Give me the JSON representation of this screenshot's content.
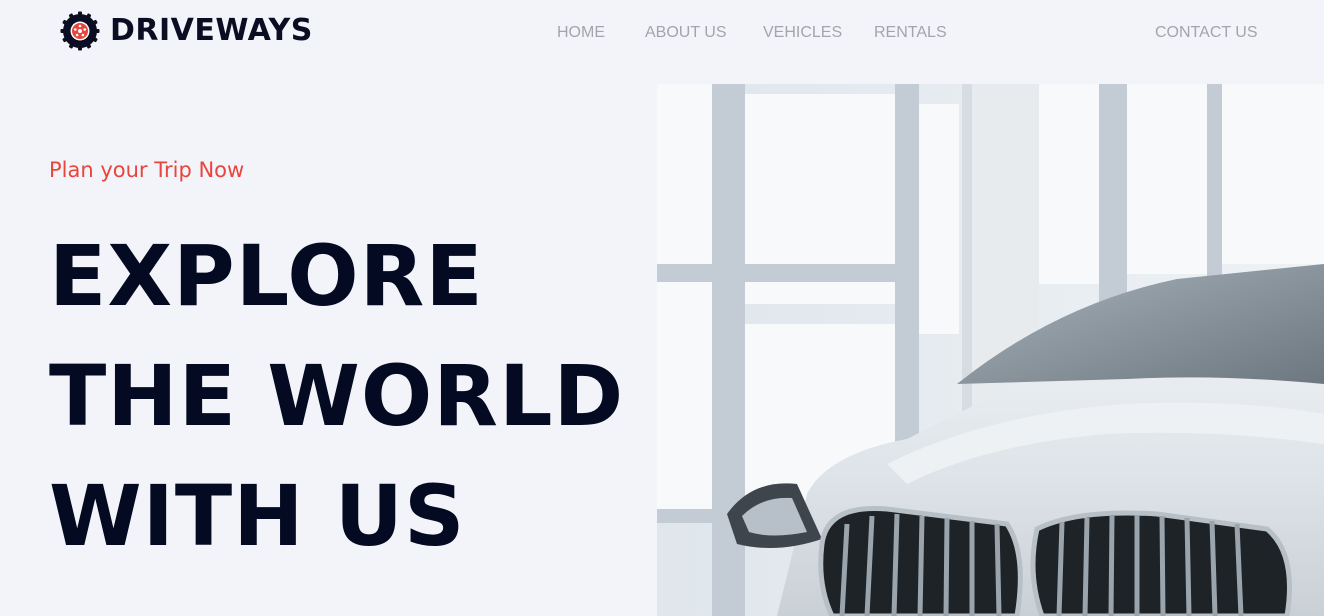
{
  "brand": {
    "name": "DRIVEWAYS",
    "accent_color": "#e8453c",
    "dark_color": "#0b0e23"
  },
  "nav": {
    "home": "HOME",
    "about": "ABOUT US",
    "vehicles": "VEHICLES",
    "rentals": "RENTALS",
    "contact": "CONTACT US"
  },
  "hero": {
    "eyebrow": "Plan your Trip Now",
    "headline_lines": [
      "EXPLORE",
      "THE WORLD",
      "WITH US"
    ],
    "image_icon": "white-sports-car-photo"
  }
}
